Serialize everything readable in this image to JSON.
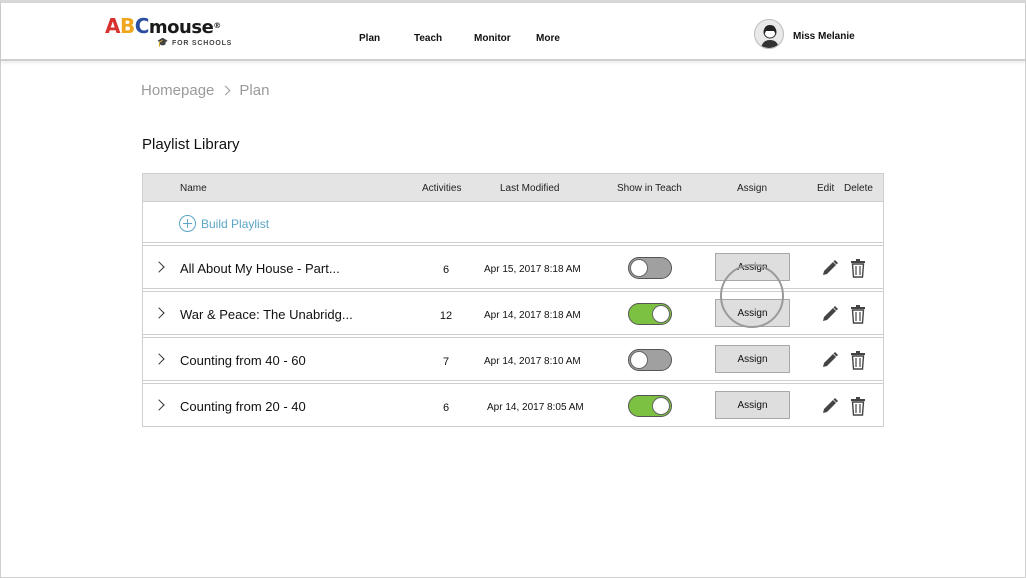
{
  "brand": {
    "logo_a": "A",
    "logo_b": "B",
    "logo_c": "C",
    "logo_rest": "mouse",
    "logo_reg": "®",
    "logo_sub": "FOR SCHOOLS"
  },
  "nav": {
    "items": [
      "Plan",
      "Teach",
      "Monitor",
      "More"
    ]
  },
  "user": {
    "name": "Miss Melanie"
  },
  "breadcrumb": {
    "items": [
      "Homepage",
      "Plan"
    ]
  },
  "page": {
    "title": "Playlist Library"
  },
  "table": {
    "headers": {
      "name": "Name",
      "activities": "Activities",
      "last_modified": "Last Modified",
      "show_in_teach": "Show in Teach",
      "assign": "Assign",
      "edit": "Edit",
      "delete": "Delete"
    },
    "build_label": "Build Playlist",
    "assign_label": "Assign",
    "rows": [
      {
        "name": "All About My House - Part...",
        "activities": "6",
        "last_modified": "Apr 15, 2017  8:18 AM",
        "show_in_teach": false
      },
      {
        "name": "War & Peace: The Unabridg...",
        "activities": "12",
        "last_modified": "Apr 14, 2017  8:18 AM",
        "show_in_teach": true
      },
      {
        "name": "Counting from 40 - 60",
        "activities": "7",
        "last_modified": "Apr 14, 2017  8:10 AM",
        "show_in_teach": false
      },
      {
        "name": "Counting from 20 - 40",
        "activities": "6",
        "last_modified": "Apr 14, 2017  8:05 AM",
        "show_in_teach": true
      }
    ]
  },
  "colors": {
    "accent_link": "#5ba5c8",
    "toggle_on": "#7cc142",
    "toggle_off": "#a0a0a0"
  }
}
